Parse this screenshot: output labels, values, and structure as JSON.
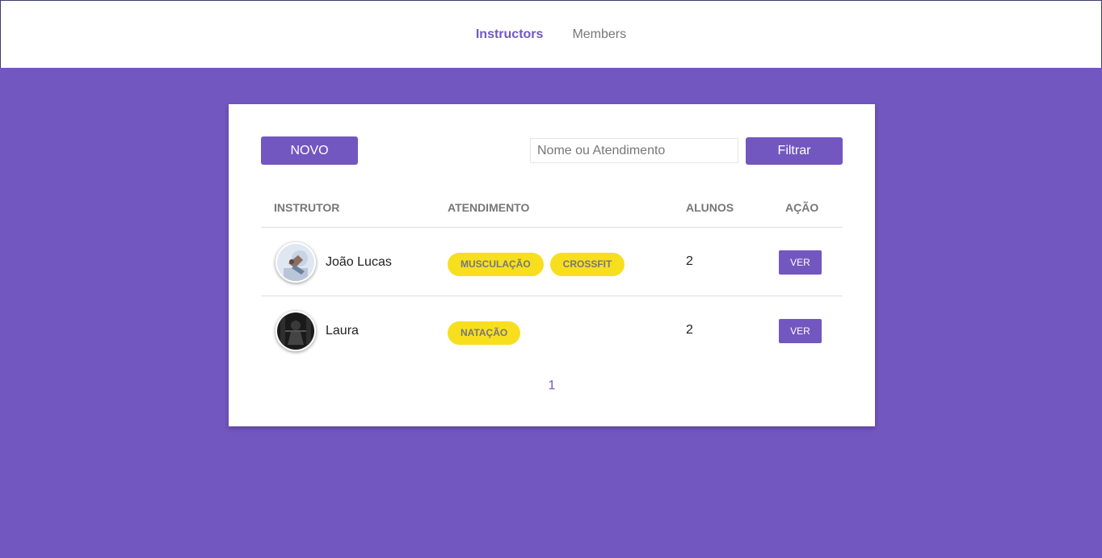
{
  "nav": {
    "items": [
      {
        "label": "Instructors",
        "active": true
      },
      {
        "label": "Members",
        "active": false
      }
    ]
  },
  "colors": {
    "accent": "#7257c1",
    "tag": "#f7df1e"
  },
  "toolbar": {
    "new_label": "NOVO",
    "search_placeholder": "Nome ou Atendimento",
    "search_value": "",
    "filter_label": "Filtrar"
  },
  "table": {
    "headers": {
      "instructor": "INSTRUTOR",
      "services": "ATENDIMENTO",
      "students": "ALUNOS",
      "action": "AÇÃO"
    },
    "rows": [
      {
        "avatar_icon": "avatar-photo-light",
        "name": "João Lucas",
        "tags": [
          "MUSCULAÇÃO",
          "CROSSFIT"
        ],
        "students": "2",
        "action_label": "VER"
      },
      {
        "avatar_icon": "avatar-photo-dark",
        "name": "Laura",
        "tags": [
          "NATAÇÃO"
        ],
        "students": "2",
        "action_label": "VER"
      }
    ]
  },
  "pagination": {
    "pages": [
      "1"
    ]
  }
}
